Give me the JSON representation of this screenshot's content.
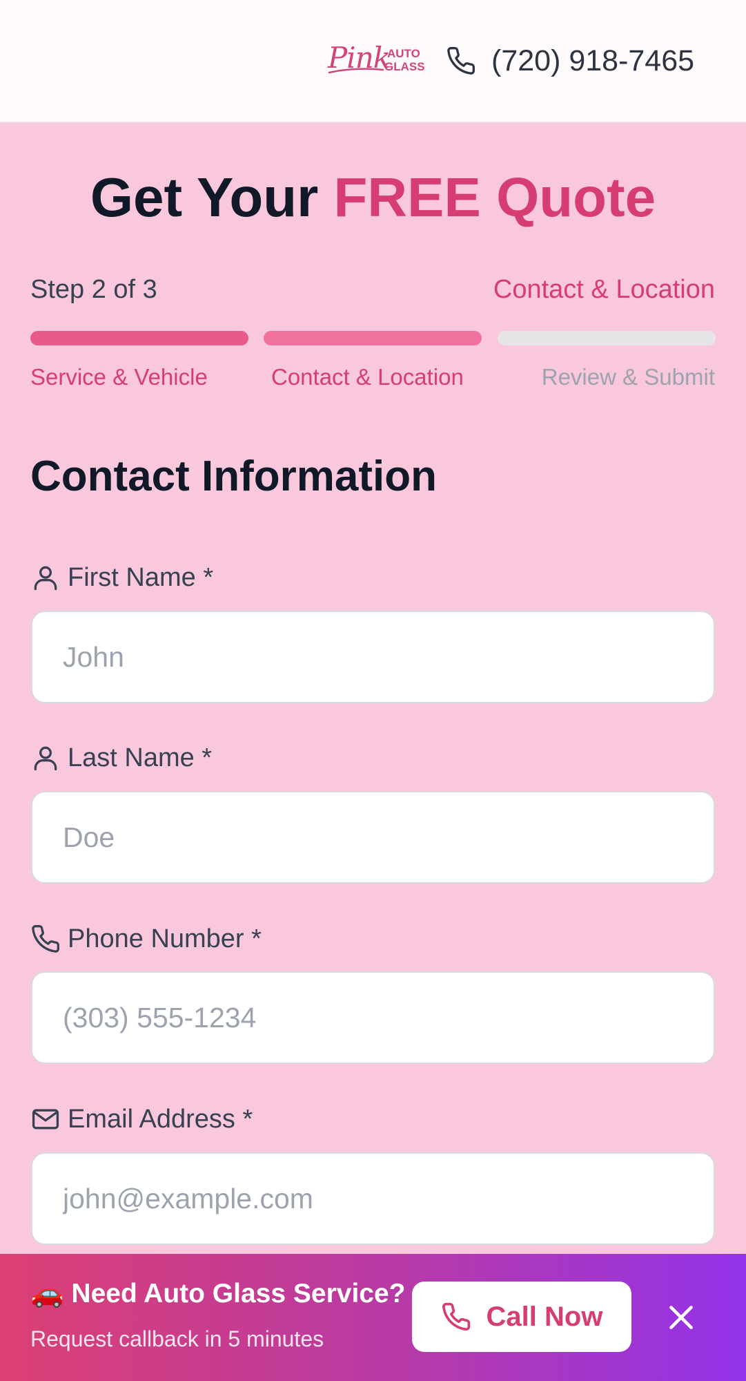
{
  "header": {
    "logo_script": "Pink",
    "logo_line1": "AUTO",
    "logo_line2": "GLASS",
    "phone_icon": "phone-icon",
    "phone_number": "(720) 918-7465"
  },
  "hero": {
    "title_plain": "Get Your ",
    "title_accent": "FREE Quote"
  },
  "progress": {
    "step_text": "Step 2 of 3",
    "current_step_name": "Contact & Location",
    "current_step": 2,
    "total_steps": 3,
    "steps": [
      {
        "label": "Service & Vehicle",
        "state": "complete"
      },
      {
        "label": "Contact & Location",
        "state": "active"
      },
      {
        "label": "Review & Submit",
        "state": "pending"
      }
    ]
  },
  "form": {
    "section_title": "Contact Information",
    "fields": [
      {
        "icon": "user-icon",
        "label": "First Name *",
        "placeholder": "John",
        "value": ""
      },
      {
        "icon": "user-icon",
        "label": "Last Name *",
        "placeholder": "Doe",
        "value": ""
      },
      {
        "icon": "phone-icon",
        "label": "Phone Number *",
        "placeholder": "(303) 555-1234",
        "value": ""
      },
      {
        "icon": "mail-icon",
        "label": "Email Address *",
        "placeholder": "john@example.com",
        "value": ""
      }
    ]
  },
  "banner": {
    "emoji": "🚗",
    "title": "Need Auto Glass Service?",
    "subtitle": "Request callback in 5 minutes",
    "call_button_label": "Call Now",
    "call_icon": "phone-icon",
    "close_icon": "close-icon"
  },
  "colors": {
    "accent": "#d63e73",
    "page_background": "#f9c8dc",
    "banner_gradient_start": "#dc3f73",
    "banner_gradient_end": "#9333ea"
  }
}
